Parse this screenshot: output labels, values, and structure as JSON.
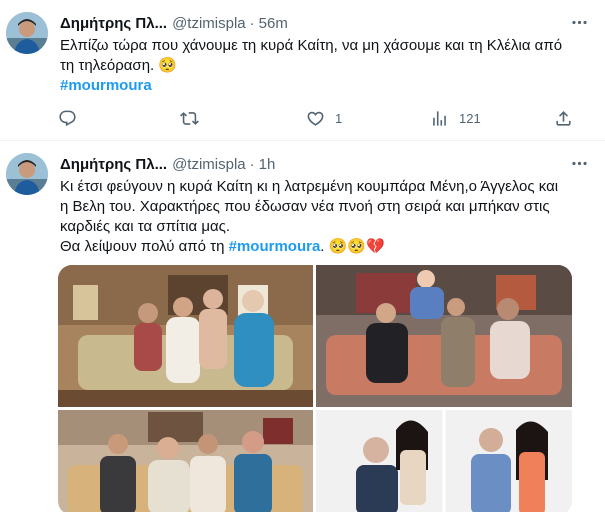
{
  "tweets": [
    {
      "name": "Δημήτρης Πλ...",
      "handle": "@tzimispla",
      "separator": "·",
      "time": "56m",
      "text_line1": "Ελπίζω τώρα που χάνουμε τη κυρά Καίτη, να μη χάσουμε και τη Κλέλια από",
      "text_line2": "τη τηλεόραση. 🥺",
      "hashtag": "#mourmoura",
      "reply_count": "",
      "retweet_count": "",
      "like_count": "1",
      "view_count": "121"
    },
    {
      "name": "Δημήτρης Πλ...",
      "handle": "@tzimispla",
      "separator": "·",
      "time": "1h",
      "text_line1": "Κι έτσι φεύγουν η κυρά Καίτη κι η λατρεμένη κουμπάρα Μένη,ο Άγγελος και",
      "text_line2": "η Βελη του. Χαρακτήρες που έδωσαν νέα πνοή στη σειρά και μπήκαν στις",
      "text_line3": "καρδιές και τα σπίτια μας.",
      "text_line4_prefix": "Θα λείψουν πολύ από τη ",
      "hashtag": "#mourmoura",
      "text_line4_suffix": ". 🥺🥺💔"
    }
  ],
  "icons": {
    "avatar": "avatar",
    "more": "more-icon",
    "reply": "reply-icon",
    "retweet": "retweet-icon",
    "like": "like-icon",
    "views": "views-icon",
    "share": "share-icon"
  },
  "colors": {
    "text": "#0f1419",
    "secondary": "#536471",
    "accent": "#1d9bf0",
    "divider": "#eff3f4"
  }
}
